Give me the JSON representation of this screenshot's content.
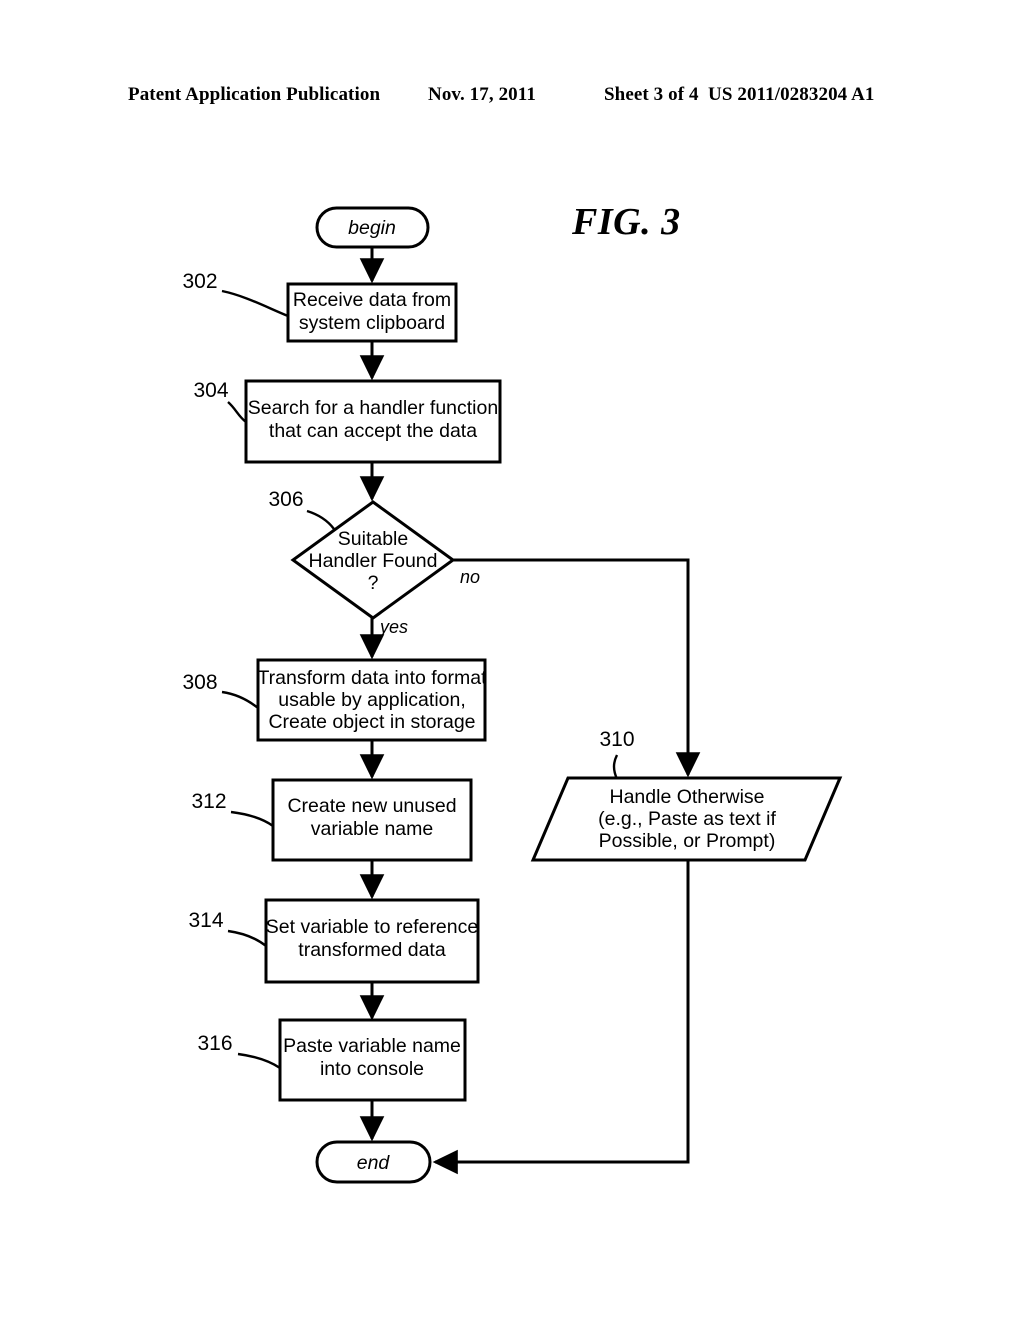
{
  "header": {
    "publication": "Patent Application Publication",
    "date": "Nov. 17, 2011",
    "sheet": "Sheet 3 of 4",
    "number": "US 2011/0283204 A1"
  },
  "figure": {
    "title": "FIG. 3"
  },
  "flowchart": {
    "begin_label": "begin",
    "end_label": "end",
    "branch_yes": "yes",
    "branch_no": "no",
    "nodes": [
      {
        "ref": "302",
        "type": "process",
        "lines": [
          "Receive data from",
          "system clipboard"
        ]
      },
      {
        "ref": "304",
        "type": "process",
        "lines": [
          "Search for a handler function",
          "that can accept the data"
        ]
      },
      {
        "ref": "306",
        "type": "decision",
        "lines": [
          "Suitable",
          "Handler Found",
          "?"
        ]
      },
      {
        "ref": "308",
        "type": "process",
        "lines": [
          "Transform data into format",
          "usable by application,",
          "Create object in storage"
        ]
      },
      {
        "ref": "310",
        "type": "io",
        "lines": [
          "Handle Otherwise",
          "(e.g., Paste as text if",
          "Possible, or Prompt)"
        ]
      },
      {
        "ref": "312",
        "type": "process",
        "lines": [
          "Create new unused",
          "variable name"
        ]
      },
      {
        "ref": "314",
        "type": "process",
        "lines": [
          "Set variable to reference",
          "transformed data"
        ]
      },
      {
        "ref": "316",
        "type": "process",
        "lines": [
          "Paste variable name",
          "into console"
        ]
      }
    ]
  },
  "colors": {
    "ink": "#000000",
    "paper": "#ffffff"
  }
}
